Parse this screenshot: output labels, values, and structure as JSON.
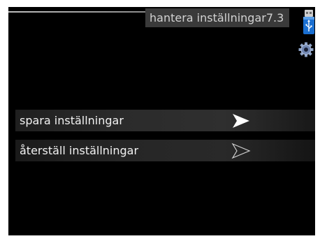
{
  "header": {
    "title": "hantera inställningar",
    "menu_number": "7.3"
  },
  "icons": {
    "usb": "usb-stick-icon",
    "settings": "gear-icon"
  },
  "menu": {
    "items": [
      {
        "label": "spara inställningar",
        "state": "selected",
        "arrow": "arrow-right-filled-icon"
      },
      {
        "label": "återställ inställningar",
        "state": "normal",
        "arrow": "arrow-right-outline-icon"
      }
    ]
  },
  "colors": {
    "screen_background": "#000000",
    "title_background": "#3a3a3a",
    "text": "#f2f2f2",
    "usb_blue": "#1a6fd1"
  }
}
